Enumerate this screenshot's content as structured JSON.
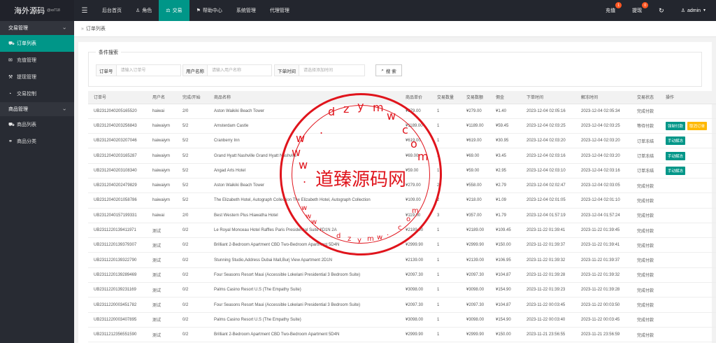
{
  "brand": {
    "name": "海外源码",
    "sub": "@xxT18"
  },
  "nav": [
    {
      "label": "后台首页",
      "icon": ""
    },
    {
      "label": "角色",
      "icon": "user-icon"
    },
    {
      "label": "交易",
      "icon": "scale-icon",
      "active": true
    },
    {
      "label": "帮助中心",
      "icon": "flag-icon"
    },
    {
      "label": "系统管理",
      "icon": ""
    },
    {
      "label": "代理管理",
      "icon": ""
    }
  ],
  "topright": {
    "recharge": "充值",
    "recharge_badge": "1",
    "withdraw": "提现",
    "withdraw_badge": "0",
    "admin": "admin"
  },
  "sidebar": {
    "group1": "交易管理",
    "items1": [
      {
        "label": "订单列表",
        "icon": "cart-icon",
        "active": true
      },
      {
        "label": "充值管理",
        "icon": "chat-icon"
      },
      {
        "label": "提现管理",
        "icon": "hammer-icon"
      },
      {
        "label": "交易控制",
        "icon": "gauge-icon"
      }
    ],
    "group2": "商品管理",
    "items2": [
      {
        "label": "商品列表",
        "icon": "cart-icon"
      },
      {
        "label": "商品分类",
        "icon": "link-icon"
      }
    ]
  },
  "breadcrumb": "订单列表",
  "search": {
    "legend": "条件搜索",
    "order_label": "订单号",
    "order_placeholder": "请输入订单号",
    "user_label": "用户名称",
    "user_placeholder": "请输入用户名称",
    "time_label": "下单时间",
    "time_placeholder": "请选择添加时间",
    "button": "搜 索"
  },
  "table": {
    "headers": [
      "订单号",
      "用户名",
      "完成/开始",
      "商品名称",
      "商品单价",
      "交易数量",
      "交易数额",
      "佣金",
      "下单时间",
      "解冻时间",
      "交易状态",
      "操作"
    ],
    "rows": [
      {
        "cells": [
          "UB2312040205165520",
          "haiwai",
          "2/0",
          "Aston Waikiki Beach Tower",
          "¥279.00",
          "1",
          "¥279.00",
          "¥1.40",
          "2023-12-04 02:05:16",
          "2023-12-04 02:05:34",
          "完成付款"
        ],
        "actions": []
      },
      {
        "cells": [
          "UB2312040203256843",
          "haiwaiym",
          "5/2",
          "Amsterdam Castle",
          "¥1189.00",
          "1",
          "¥1189.00",
          "¥59.45",
          "2023-12-04 02:03:25",
          "2023-12-04 02:03:25",
          "等待付款"
        ],
        "actions": [
          {
            "label": "强制付款",
            "color": "green"
          },
          {
            "label": "取消订单",
            "color": "orange"
          }
        ]
      },
      {
        "cells": [
          "UB2312040203207046",
          "haiwaiym",
          "5/2",
          "Cranberry Inn",
          "¥619.00",
          "1",
          "¥619.00",
          "¥30.95",
          "2023-12-04 02:03:20",
          "2023-12-04 02:03:20",
          "订单冻结"
        ],
        "actions": [
          {
            "label": "手动解冻",
            "color": "green"
          }
        ]
      },
      {
        "cells": [
          "UB2312040203165287",
          "haiwaiym",
          "5/2",
          "Grand Hyatt Nashville Grand Hyatt Nashville",
          "¥69.00",
          "1",
          "¥69.00",
          "¥3.45",
          "2023-12-04 02:03:16",
          "2023-12-04 02:03:20",
          "订单冻结"
        ],
        "actions": [
          {
            "label": "手动解冻",
            "color": "green"
          }
        ]
      },
      {
        "cells": [
          "UB2312040203108340",
          "haiwaiym",
          "5/2",
          "Angad Arts Hotel",
          "¥59.00",
          "1",
          "¥59.00",
          "¥2.95",
          "2023-12-04 02:03:10",
          "2023-12-04 02:03:16",
          "订单冻结"
        ],
        "actions": [
          {
            "label": "手动解冻",
            "color": "green"
          }
        ]
      },
      {
        "cells": [
          "UB2312040202479829",
          "haiwaiym",
          "5/2",
          "Aston Waikiki Beach Tower",
          "¥279.00",
          "2",
          "¥558.00",
          "¥2.79",
          "2023-12-04 02:02:47",
          "2023-12-04 02:03:05",
          "完成付款"
        ],
        "actions": []
      },
      {
        "cells": [
          "UB2312040201058786",
          "haiwaiym",
          "5/2",
          "The Elizabeth Hotel, Autograph Collection The Elizabeth Hotel, Autograph Collection",
          "¥109.00",
          "2",
          "¥218.00",
          "¥1.09",
          "2023-12-04 02:01:05",
          "2023-12-04 02:01:10",
          "完成付款"
        ],
        "actions": []
      },
      {
        "cells": [
          "UB2312040157199331",
          "haiwai",
          "2/0",
          "Best Western Plus Hiawatha Hotel",
          "¥119.00",
          "3",
          "¥357.00",
          "¥1.79",
          "2023-12-04 01:57:19",
          "2023-12-04 01:57:24",
          "完成付款"
        ],
        "actions": []
      },
      {
        "cells": [
          "UB2311220139411971",
          "测试",
          "0/2",
          "Le Royal Monceau Hotel Raffles Paris Presidential Suite 2D1N 2A",
          "¥2189.00",
          "1",
          "¥2189.00",
          "¥109.45",
          "2023-11-22 01:39:41",
          "2023-11-22 01:39:45",
          "完成付款"
        ],
        "actions": []
      },
      {
        "cells": [
          "UB2311220139379307",
          "测试",
          "0/2",
          "Brilliant 2-Bedroom Apartment CBD Two-Bedroom Apartment 5D4N",
          "¥2999.90",
          "1",
          "¥2999.90",
          "¥150.00",
          "2023-11-22 01:39:37",
          "2023-11-22 01:39:41",
          "完成付款"
        ],
        "actions": []
      },
      {
        "cells": [
          "UB2311220139322790",
          "测试",
          "0/2",
          "Stunning Studio,Address Dubai Mall,Burj View Apartment 2D1N",
          "¥2139.00",
          "1",
          "¥2139.00",
          "¥106.95",
          "2023-11-22 01:39:32",
          "2023-11-22 01:39:37",
          "完成付款"
        ],
        "actions": []
      },
      {
        "cells": [
          "UB2311220139289469",
          "测试",
          "0/2",
          "Four Seasons Resort Maui (Accessible Lokelani Presidential 3 Bedroom Suite)",
          "¥2097.30",
          "1",
          "¥2097.30",
          "¥104.87",
          "2023-11-22 01:39:28",
          "2023-11-22 01:39:32",
          "完成付款"
        ],
        "actions": []
      },
      {
        "cells": [
          "UB2311220139231169",
          "测试",
          "0/2",
          "Palms Casino Resort U.S (The Empathy Suite)",
          "¥3098.00",
          "1",
          "¥3098.00",
          "¥154.90",
          "2023-11-22 01:39:23",
          "2023-11-22 01:39:28",
          "完成付款"
        ],
        "actions": []
      },
      {
        "cells": [
          "UB2311220003451782",
          "测试",
          "0/2",
          "Four Seasons Resort Maui (Accessible Lokelani Presidential 3 Bedroom Suite)",
          "¥2097.30",
          "1",
          "¥2097.30",
          "¥104.87",
          "2023-11-22 00:03:45",
          "2023-11-22 00:03:50",
          "完成付款"
        ],
        "actions": []
      },
      {
        "cells": [
          "UB2311220003407895",
          "测试",
          "0/2",
          "Palms Casino Resort U.S (The Empathy Suite)",
          "¥3098.00",
          "1",
          "¥3098.00",
          "¥154.90",
          "2023-11-22 00:03:40",
          "2023-11-22 00:03:45",
          "完成付款"
        ],
        "actions": []
      },
      {
        "cells": [
          "UB2311212356551590",
          "测试",
          "0/2",
          "Brilliant 2-Bedroom Apartment CBD Two-Bedroom Apartment 5D4N",
          "¥2999.90",
          "1",
          "¥2999.90",
          "¥150.00",
          "2023-11-21 23:56:55",
          "2023-11-21 23:56:59",
          "完成付款"
        ],
        "actions": []
      }
    ]
  },
  "watermark": {
    "center": "道臻源码网",
    "letters": [
      "d",
      "z",
      "y",
      "m",
      "w",
      ".",
      "c",
      "o",
      "m",
      "w",
      "w",
      "w",
      "."
    ],
    "small": [
      "w",
      "w",
      "w",
      ".",
      "d",
      "z",
      "y",
      "m",
      "w",
      ".",
      "c",
      "o",
      "m"
    ]
  },
  "colors": {
    "accent": "#009688",
    "topbar": "#23262e",
    "sidebar": "#282b33",
    "badge": "#ff5722",
    "warning": "#ffb800",
    "stamp": "#e0141c"
  }
}
